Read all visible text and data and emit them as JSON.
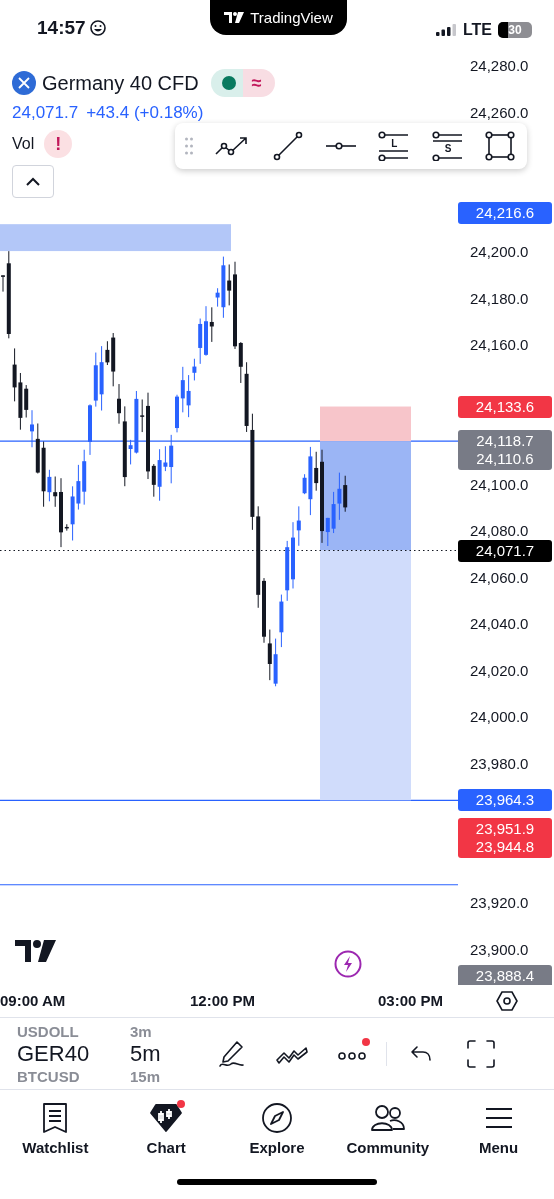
{
  "status_bar": {
    "time": "14:57",
    "island_title": "TradingView",
    "network": "LTE",
    "battery": "30"
  },
  "legend": {
    "symbol": "Germany 40 CFD",
    "market_open": true,
    "delay_mark": "≈",
    "price": "24,071.7",
    "change": "+43.4 (+0.18%)",
    "volume_label": "Vol",
    "volume_alert": "!"
  },
  "drawing_toolbar": {
    "tools": [
      {
        "kind": "path"
      },
      {
        "kind": "line"
      },
      {
        "kind": "ray"
      },
      {
        "kind": "long",
        "label": "L"
      },
      {
        "kind": "short",
        "label": "S"
      },
      {
        "kind": "rectangle"
      }
    ]
  },
  "price_axis": {
    "ticks": [
      "24,280.0",
      "24,260.0",
      "24,200.0",
      "24,180.0",
      "24,160.0",
      "24,100.0",
      "24,080.0",
      "24,060.0",
      "24,040.0",
      "24,020.0",
      "24,000.0",
      "23,980.0",
      "23,920.0",
      "23,900.0"
    ],
    "badges": [
      {
        "lines": [
          "24,216.6"
        ],
        "color": "#2962ff"
      },
      {
        "lines": [
          "24,133.6"
        ],
        "color": "#f23645"
      },
      {
        "lines": [
          "24,118.7",
          "24,110.6"
        ],
        "color": "#787b86"
      },
      {
        "lines": [
          "24,071.7"
        ],
        "color": "#000000"
      },
      {
        "lines": [
          "23,964.3"
        ],
        "color": "#2962ff"
      },
      {
        "lines": [
          "23,951.9",
          "23,944.8"
        ],
        "color": "#f23645"
      },
      {
        "lines": [
          "23,888.4"
        ],
        "color": "#787b86"
      }
    ]
  },
  "time_axis": [
    "09:00 AM",
    "12:00 PM",
    "03:00 PM"
  ],
  "symbol_picker": [
    {
      "symbol": "USDOLL",
      "interval": "3m",
      "selected": false
    },
    {
      "symbol": "GER40",
      "interval": "5m",
      "selected": true
    },
    {
      "symbol": "BTCUSD",
      "interval": "15m",
      "selected": false
    }
  ],
  "chart_actions": [
    {
      "kind": "draw",
      "badge": false
    },
    {
      "kind": "indicators",
      "badge": false
    },
    {
      "kind": "more",
      "badge": true
    },
    {
      "kind": "undo",
      "badge": false
    },
    {
      "kind": "fullscreen",
      "badge": false
    }
  ],
  "tabs": [
    {
      "kind": "watchlist",
      "label": "Watchlist",
      "selected": false,
      "badge": false
    },
    {
      "kind": "chart",
      "label": "Chart",
      "selected": true,
      "badge": true
    },
    {
      "kind": "explore",
      "label": "Explore",
      "selected": false,
      "badge": false
    },
    {
      "kind": "community",
      "label": "Community",
      "selected": false,
      "badge": false
    },
    {
      "kind": "menu",
      "label": "Menu",
      "selected": false,
      "badge": false
    }
  ]
}
